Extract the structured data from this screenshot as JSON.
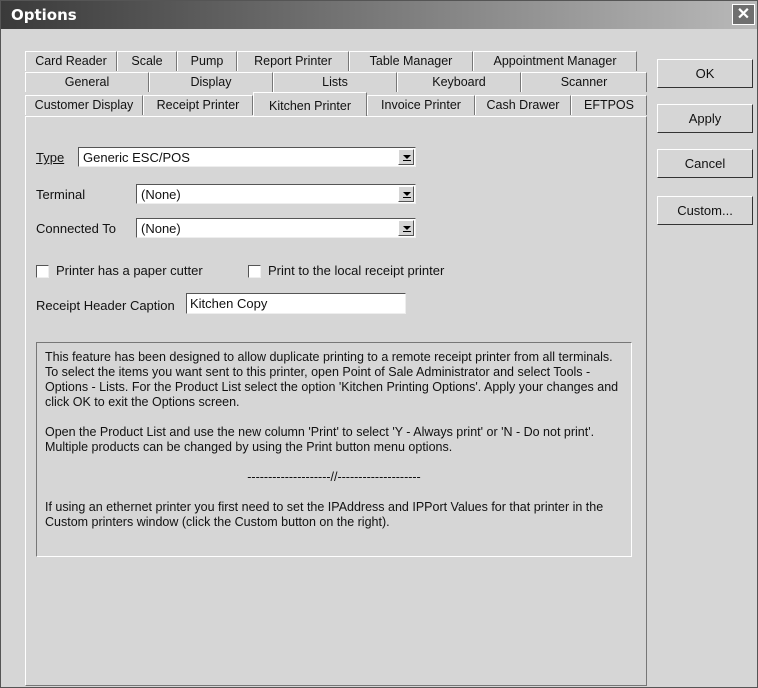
{
  "window": {
    "title": "Options",
    "close_glyph": "✕"
  },
  "tabs": {
    "row1": [
      "Card Reader",
      "Scale",
      "Pump",
      "Report Printer",
      "Table Manager",
      "Appointment Manager"
    ],
    "row2": [
      "General",
      "Display",
      "Lists",
      "Keyboard",
      "Scanner"
    ],
    "row3": [
      "Customer Display",
      "Receipt Printer",
      "Kitchen Printer",
      "Invoice Printer",
      "Cash Drawer",
      "EFTPOS"
    ],
    "active": "Kitchen Printer"
  },
  "form": {
    "type_label": "Type",
    "type_value": "Generic ESC/POS",
    "terminal_label": "Terminal",
    "terminal_value": "(None)",
    "connected_label": "Connected To",
    "connected_value": "(None)",
    "cutter_label": "Printer has a paper cutter",
    "cutter_checked": false,
    "local_label": "Print to the local receipt printer",
    "local_checked": false,
    "header_caption_label": "Receipt Header Caption",
    "header_caption_value": "Kitchen Copy"
  },
  "info": {
    "p1": "This feature has been designed to allow duplicate printing to a remote receipt printer from all terminals. To select the items you want sent to this printer, open Point of Sale Administrator and select Tools - Options - Lists. For the Product List select the option 'Kitchen Printing Options'. Apply your changes and click OK to exit the Options screen.",
    "p2": "Open the Product List and use the new column 'Print' to select 'Y - Always print' or 'N - Do not print'. Multiple products can be changed by using the Print button menu options.",
    "separator": "--------------------//--------------------",
    "p3": "If using an ethernet printer you first need to set the IPAddress and IPPort Values for that printer in the Custom printers window (click the Custom button on the right)."
  },
  "buttons": {
    "ok": "OK",
    "apply": "Apply",
    "cancel": "Cancel",
    "custom": "Custom..."
  },
  "colors": {
    "face": "#d6d6d6",
    "title_dark": "#3a3a3a"
  }
}
